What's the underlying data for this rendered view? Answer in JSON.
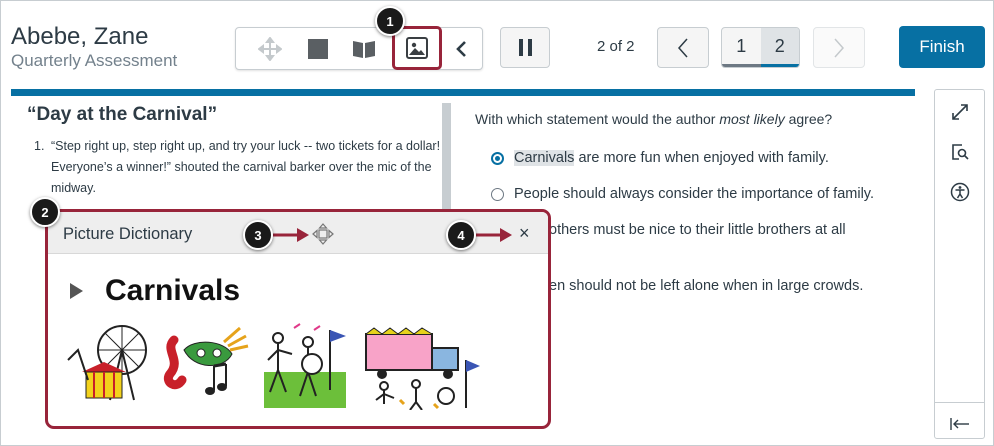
{
  "student": {
    "name": "Abebe, Zane",
    "assessment": "Quarterly Assessment"
  },
  "toolbar": {
    "tools": [
      {
        "name": "move",
        "icon": "move-arrows-icon"
      },
      {
        "name": "stop",
        "icon": "square-icon"
      },
      {
        "name": "dictionary",
        "icon": "book-icon"
      },
      {
        "name": "picture-dictionary",
        "icon": "picture-icon"
      },
      {
        "name": "collapse",
        "icon": "chevron-left-icon"
      }
    ]
  },
  "nav": {
    "page_count": "2 of 2",
    "pages": [
      "1",
      "2"
    ],
    "current_page": "2",
    "finish_label": "Finish"
  },
  "passage": {
    "title": "“Day at the Carnival”",
    "paragraph_number": "1.",
    "paragraph_text": "“Step right up, step right up, and try your luck -- two tickets for a dollar! Everyone’s a winner!” shouted the carnival barker over the mic of the midway."
  },
  "question": {
    "prompt_start": "With which statement would the author ",
    "prompt_emphasis": "most likely",
    "prompt_end": " agree?",
    "options": {
      "o1_highlight": "Carnivals",
      "o1_rest": " are more fun when enjoyed with family.",
      "o2": "People should always consider the importance of family.",
      "o3_line1": "others must be nice to their little brothers at all",
      "o4": "en should not be left alone when in large crowds."
    }
  },
  "sidebar": {
    "icons": [
      "expand-icon",
      "magnifier-icon",
      "accessibility-icon",
      "collapse-panel-icon"
    ]
  },
  "dictionary": {
    "title": "Picture Dictionary",
    "word": "Carnivals",
    "close_label": "×"
  },
  "callouts": [
    "1",
    "2",
    "3",
    "4"
  ],
  "colors": {
    "accent": "#0770a3",
    "callout_border": "#98243a",
    "badge": "#1a1a1a"
  }
}
